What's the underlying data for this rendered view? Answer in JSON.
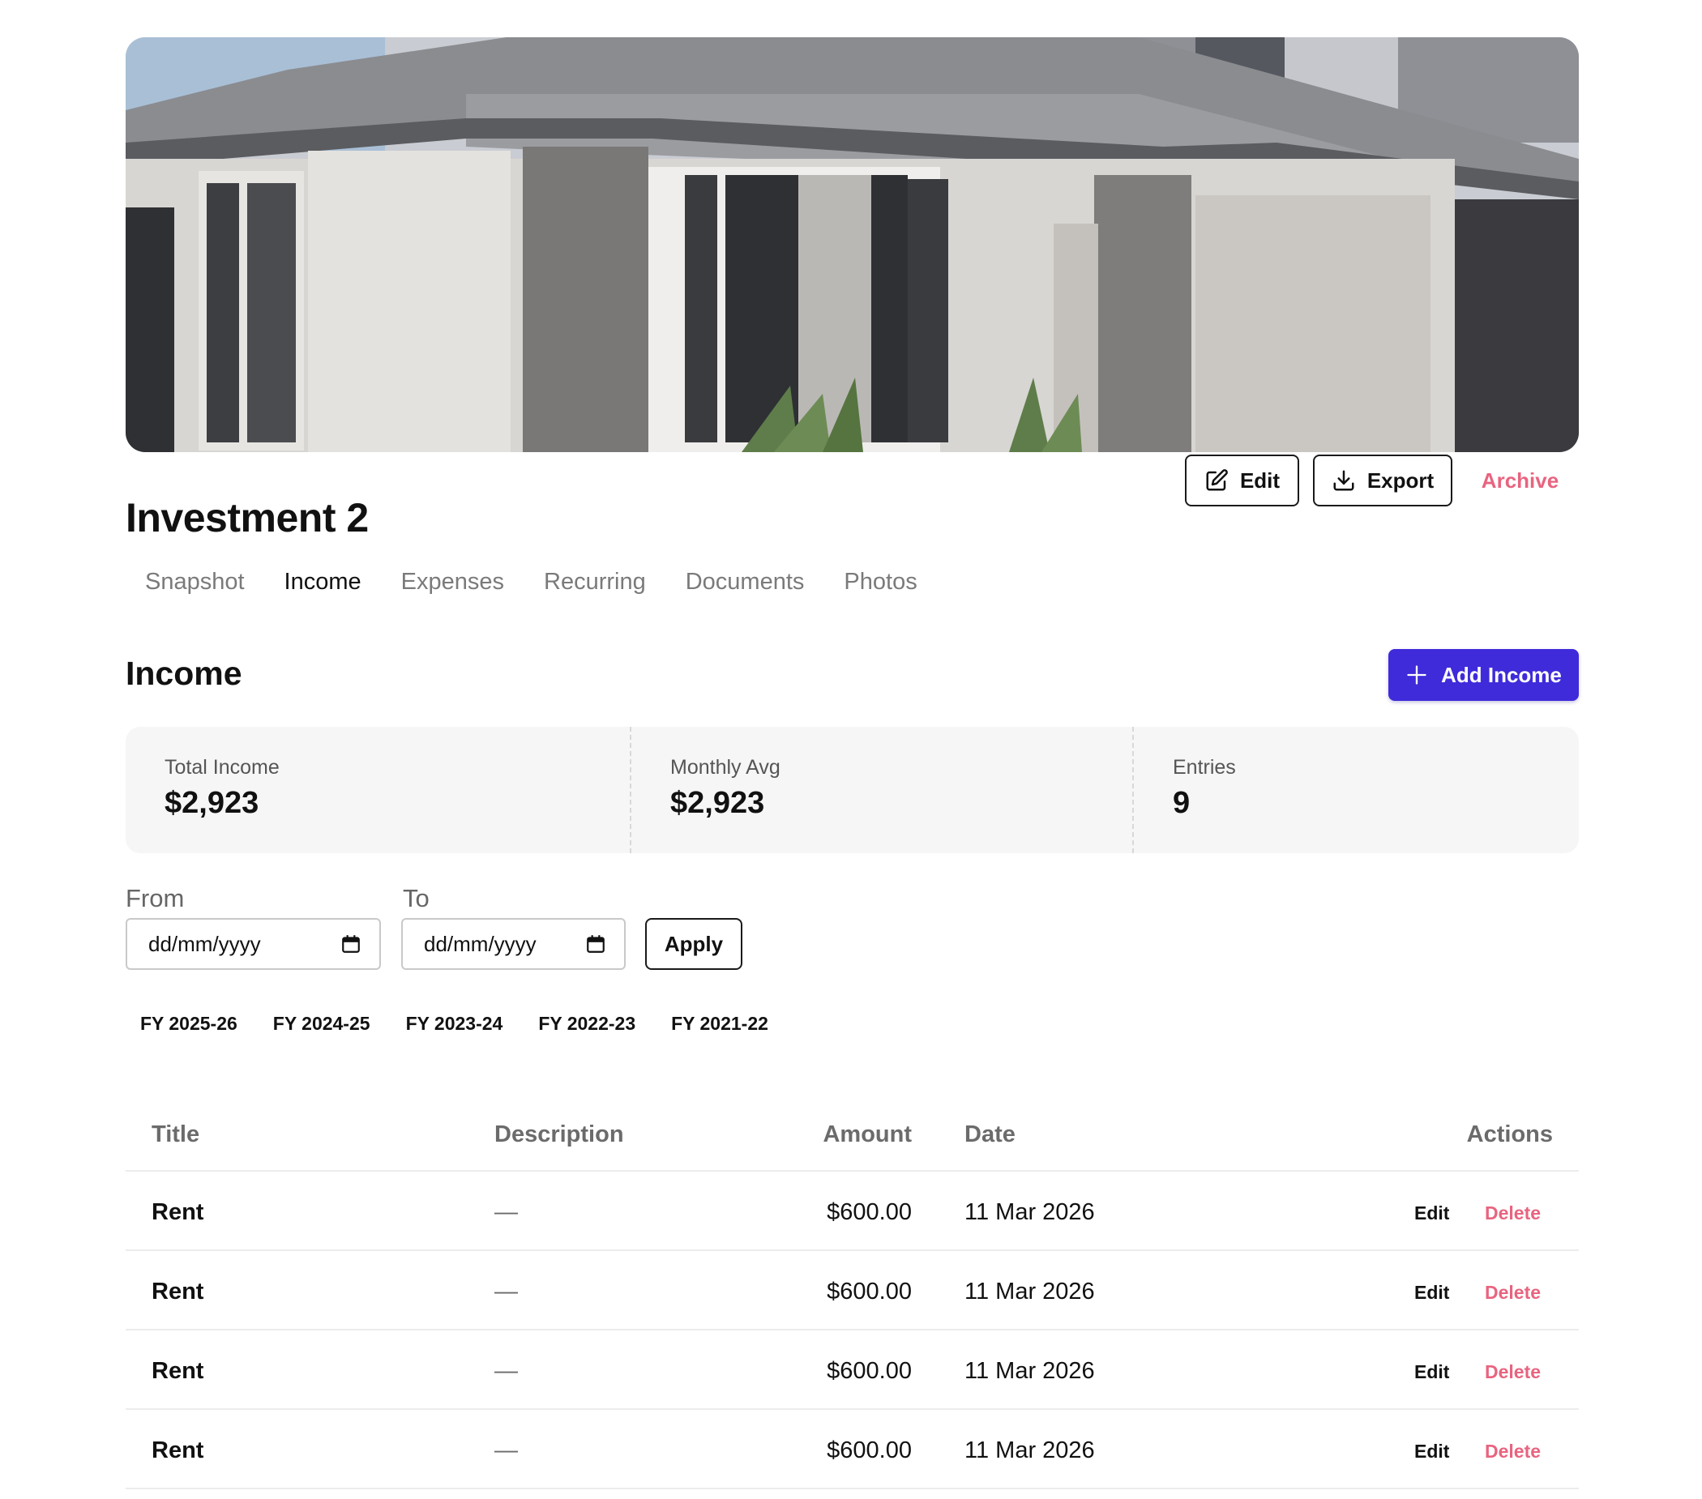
{
  "property": {
    "title": "Investment 2",
    "hero_image": "house-exterior-photo"
  },
  "header_actions": {
    "edit_label": "Edit",
    "export_label": "Export",
    "archive_label": "Archive"
  },
  "tabs": [
    {
      "label": "Snapshot",
      "active": false
    },
    {
      "label": "Income",
      "active": true
    },
    {
      "label": "Expenses",
      "active": false
    },
    {
      "label": "Recurring",
      "active": false
    },
    {
      "label": "Documents",
      "active": false
    },
    {
      "label": "Photos",
      "active": false
    }
  ],
  "section": {
    "title": "Income",
    "add_label": "Add Income"
  },
  "stats": [
    {
      "label": "Total Income",
      "value": "$2,923"
    },
    {
      "label": "Monthly Avg",
      "value": "$2,923"
    },
    {
      "label": "Entries",
      "value": "9"
    }
  ],
  "filters": {
    "from_label": "From",
    "to_label": "To",
    "from_placeholder": "dd/mm/yyyy",
    "to_placeholder": "dd/mm/yyyy",
    "apply_label": "Apply",
    "fiscal_years": [
      "FY 2025-26",
      "FY 2024-25",
      "FY 2023-24",
      "FY 2022-23",
      "FY 2021-22"
    ]
  },
  "table": {
    "columns": [
      "Title",
      "Description",
      "Amount",
      "Date",
      "Actions"
    ],
    "rows": [
      {
        "title": "Rent",
        "description": "—",
        "amount": "$600.00",
        "date": "11 Mar 2026"
      },
      {
        "title": "Rent",
        "description": "—",
        "amount": "$600.00",
        "date": "11 Mar 2026"
      },
      {
        "title": "Rent",
        "description": "—",
        "amount": "$600.00",
        "date": "11 Mar 2026"
      },
      {
        "title": "Rent",
        "description": "—",
        "amount": "$600.00",
        "date": "11 Mar 2026"
      }
    ],
    "edit_label": "Edit",
    "delete_label": "Delete"
  },
  "colors": {
    "primary": "#3f2bd9",
    "danger": "#e8647f",
    "text": "#111111",
    "muted": "#7a7a7a"
  }
}
